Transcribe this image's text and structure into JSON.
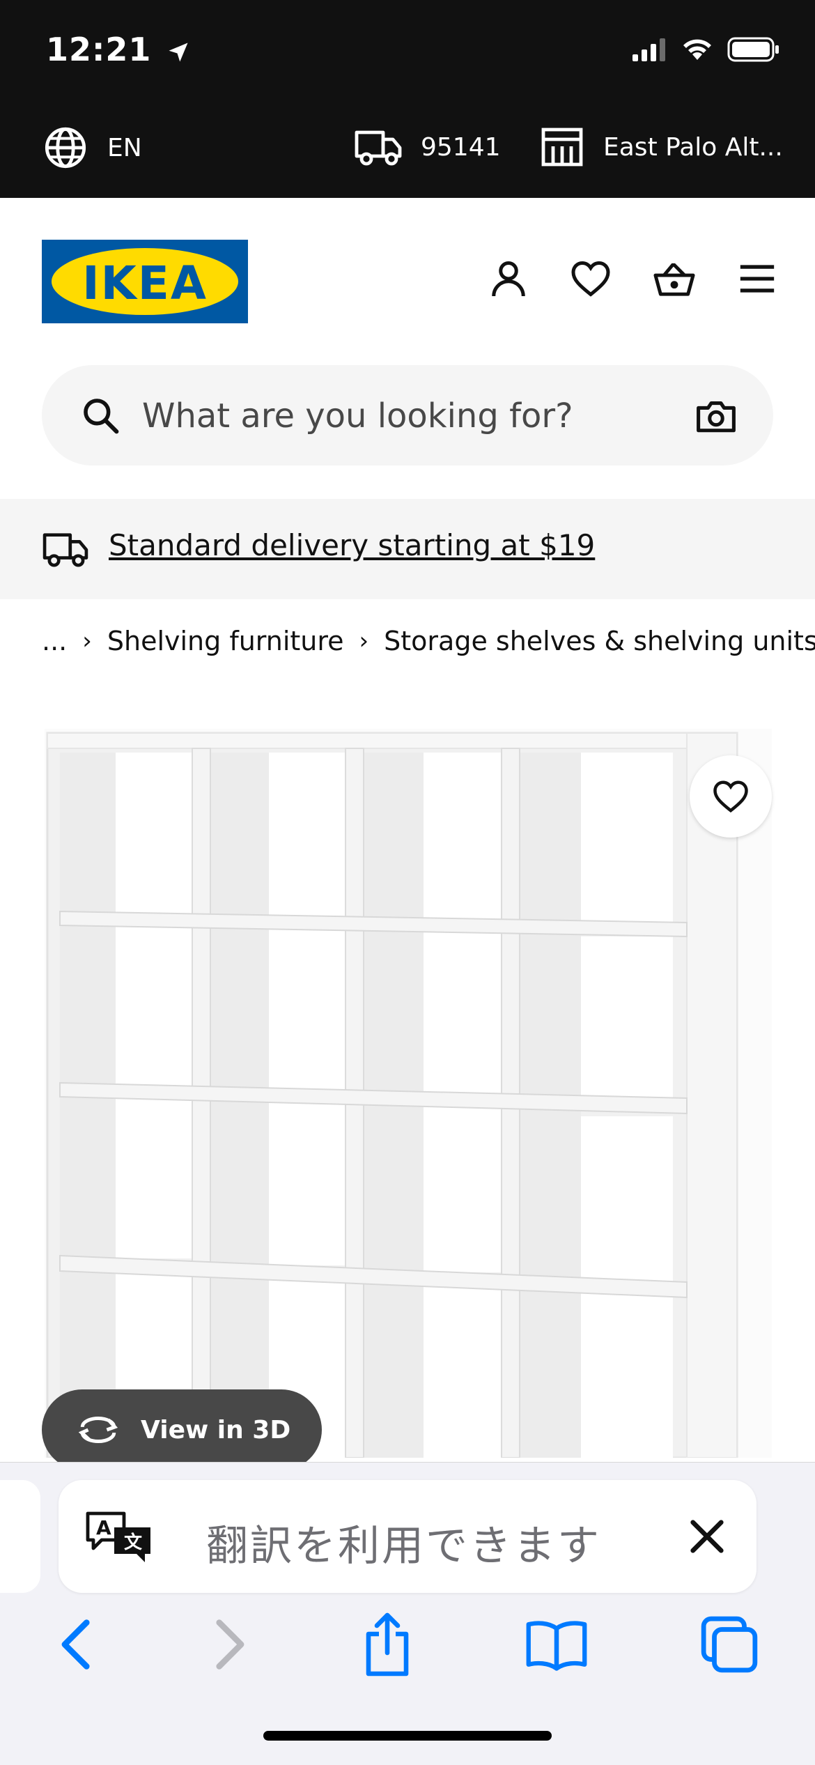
{
  "status_bar": {
    "time": "12:21"
  },
  "top_strip": {
    "language": "EN",
    "zip_code": "95141",
    "store": "East Palo Alt..."
  },
  "header": {
    "logo_text": "IKEA"
  },
  "search": {
    "placeholder": "What are you looking for?"
  },
  "delivery": {
    "text": "Standard delivery starting at $19"
  },
  "breadcrumb": {
    "ellipsis": "...",
    "items": [
      "Shelving furniture",
      "Storage shelves & shelving units"
    ]
  },
  "product": {
    "view_3d_label": "View in 3D"
  },
  "translate_banner": {
    "text": "翻訳を利用できます"
  },
  "colors": {
    "ikea_blue": "#0058a3",
    "ikea_yellow": "#ffdb00",
    "safari_blue": "#007aff",
    "top_bar": "#111111"
  }
}
